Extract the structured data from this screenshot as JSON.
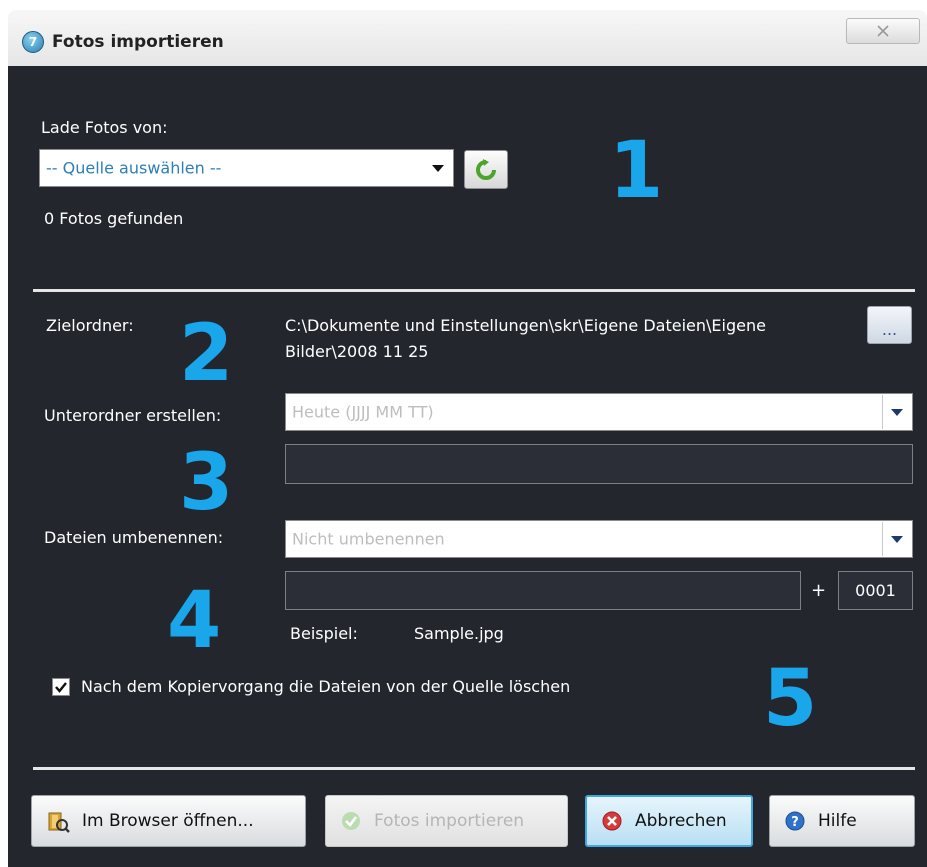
{
  "window": {
    "title": "Fotos importieren",
    "app_icon_glyph": "7",
    "close_glyph": "☒",
    "close_icon": "close-icon"
  },
  "source": {
    "label": "Lade Fotos von:",
    "selected": "-- Quelle auswählen --",
    "refresh_icon": "refresh-icon",
    "found_text": "0 Fotos gefunden"
  },
  "destination": {
    "label": "Zielordner:",
    "path_line1": "C:\\Dokumente und Einstellungen\\skr\\Eigene Dateien\\Eigene",
    "path_line2": "Bilder\\2008 11 25",
    "browse_label": "..."
  },
  "subfolder": {
    "label": "Unterordner erstellen:",
    "selected": "Heute (JJJJ MM TT)",
    "custom_value": ""
  },
  "rename": {
    "label": "Dateien umbenennen:",
    "selected": "Nicht umbenennen",
    "prefix_value": "",
    "plus": "+",
    "counter_value": "0001",
    "example_label": "Beispiel:",
    "example_value": "Sample.jpg"
  },
  "delete_option": {
    "label": "Nach dem Kopiervorgang die Dateien von der Quelle löschen",
    "checked": true
  },
  "annotations": [
    "1",
    "2",
    "3",
    "4",
    "5"
  ],
  "buttons": {
    "open_browser": "Im Browser öffnen...",
    "import": "Fotos importieren",
    "cancel": "Abbrechen",
    "help": "Hilfe"
  },
  "colors": {
    "dialog_bg": "#24262e",
    "annotation": "#1aa6ea",
    "default_button_border": "#3fa8e0"
  }
}
